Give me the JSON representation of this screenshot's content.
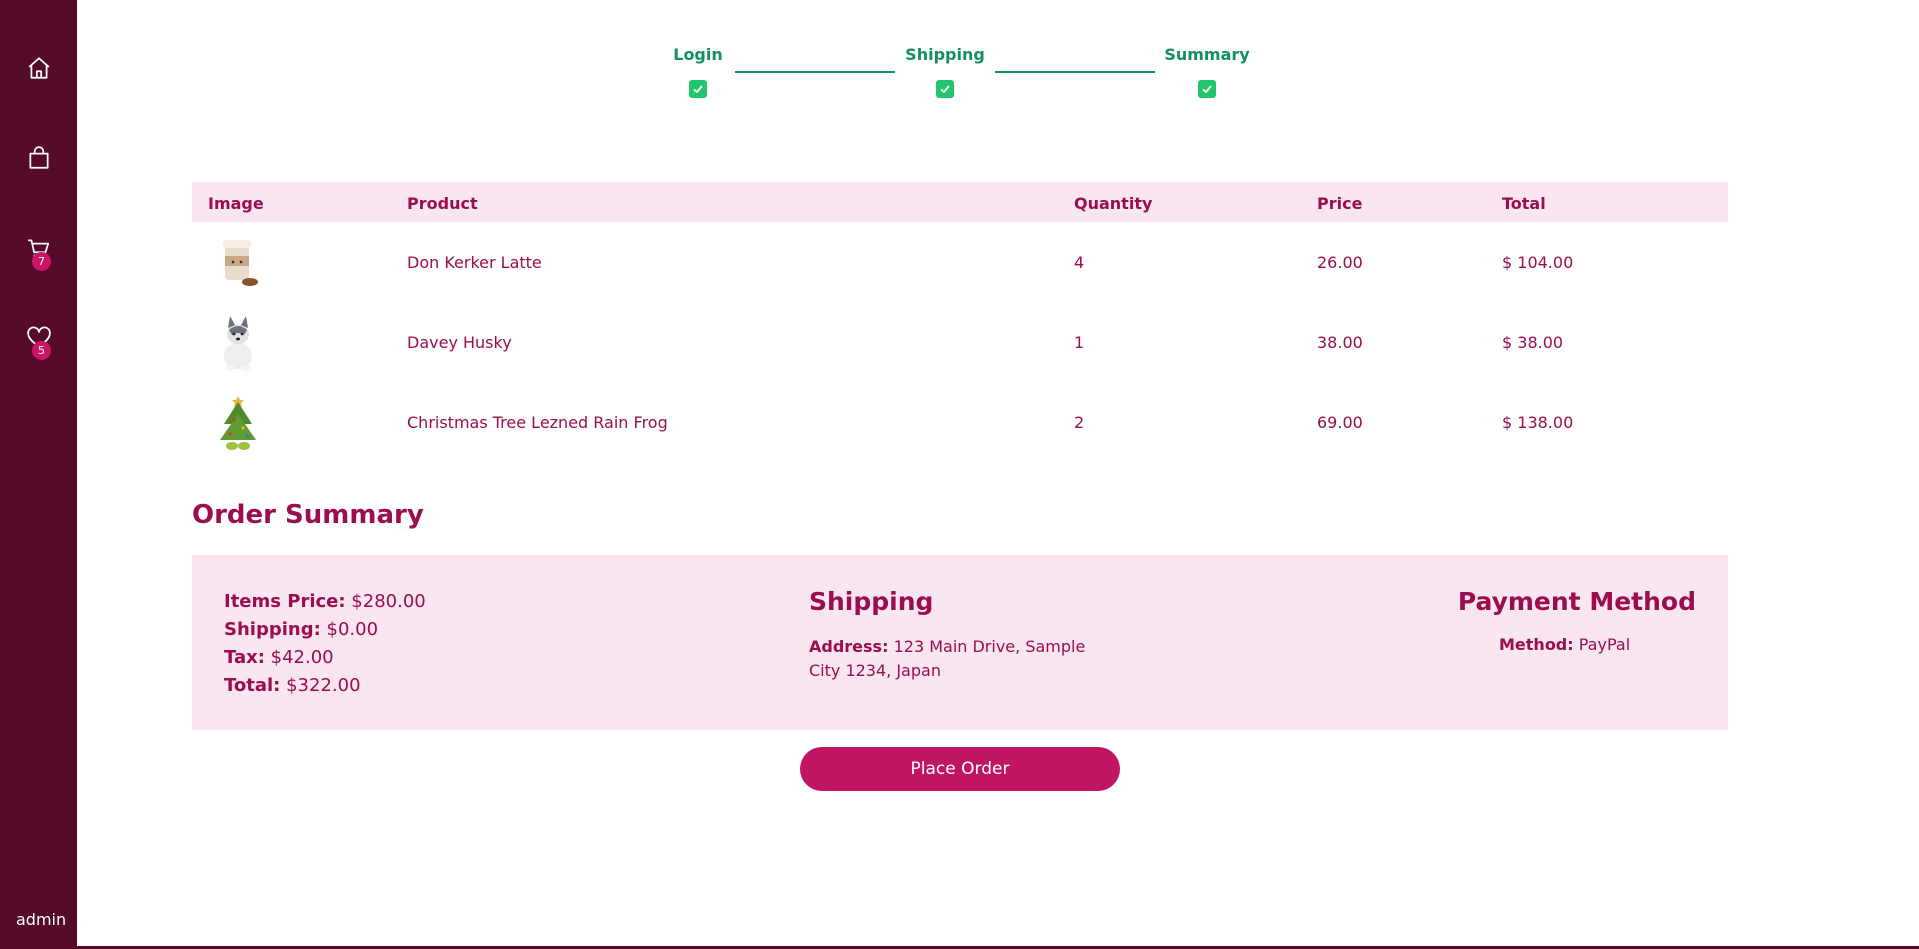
{
  "sidebar": {
    "items": [
      {
        "icon": "home-icon"
      },
      {
        "icon": "shopping-bag-icon"
      },
      {
        "icon": "cart-icon",
        "badge": "7"
      },
      {
        "icon": "heart-icon",
        "badge": "5"
      }
    ],
    "user": "admin"
  },
  "steps": [
    {
      "label": "Login",
      "done": true
    },
    {
      "label": "Shipping",
      "done": true
    },
    {
      "label": "Summary",
      "done": true
    }
  ],
  "table": {
    "headers": [
      "Image",
      "Product",
      "Quantity",
      "Price",
      "Total"
    ],
    "rows": [
      {
        "product": "Don Kerker Latte",
        "quantity": "4",
        "price": "26.00",
        "total": "$ 104.00"
      },
      {
        "product": "Davey Husky",
        "quantity": "1",
        "price": "38.00",
        "total": "$ 38.00"
      },
      {
        "product": "Christmas Tree Lezned Rain Frog",
        "quantity": "2",
        "price": "69.00",
        "total": "$ 138.00"
      }
    ]
  },
  "summary": {
    "title": "Order Summary",
    "items_price_label": "Items Price:",
    "items_price": "$280.00",
    "shipping_label": "Shipping:",
    "shipping": "$0.00",
    "tax_label": "Tax:",
    "tax": "$42.00",
    "total_label": "Total:",
    "total": "$322.00",
    "shipping_title": "Shipping",
    "address_label": "Address:",
    "address": "123 Main Drive, Sample City 1234, Japan",
    "payment_title": "Payment Method",
    "method_label": "Method:",
    "method": "PayPal"
  },
  "place_order_label": "Place Order",
  "colors": {
    "sidebar": "#550a28",
    "accent": "#c01560",
    "text": "#9b0d4f",
    "step_green": "#12915f",
    "panel": "#fae6f1"
  }
}
